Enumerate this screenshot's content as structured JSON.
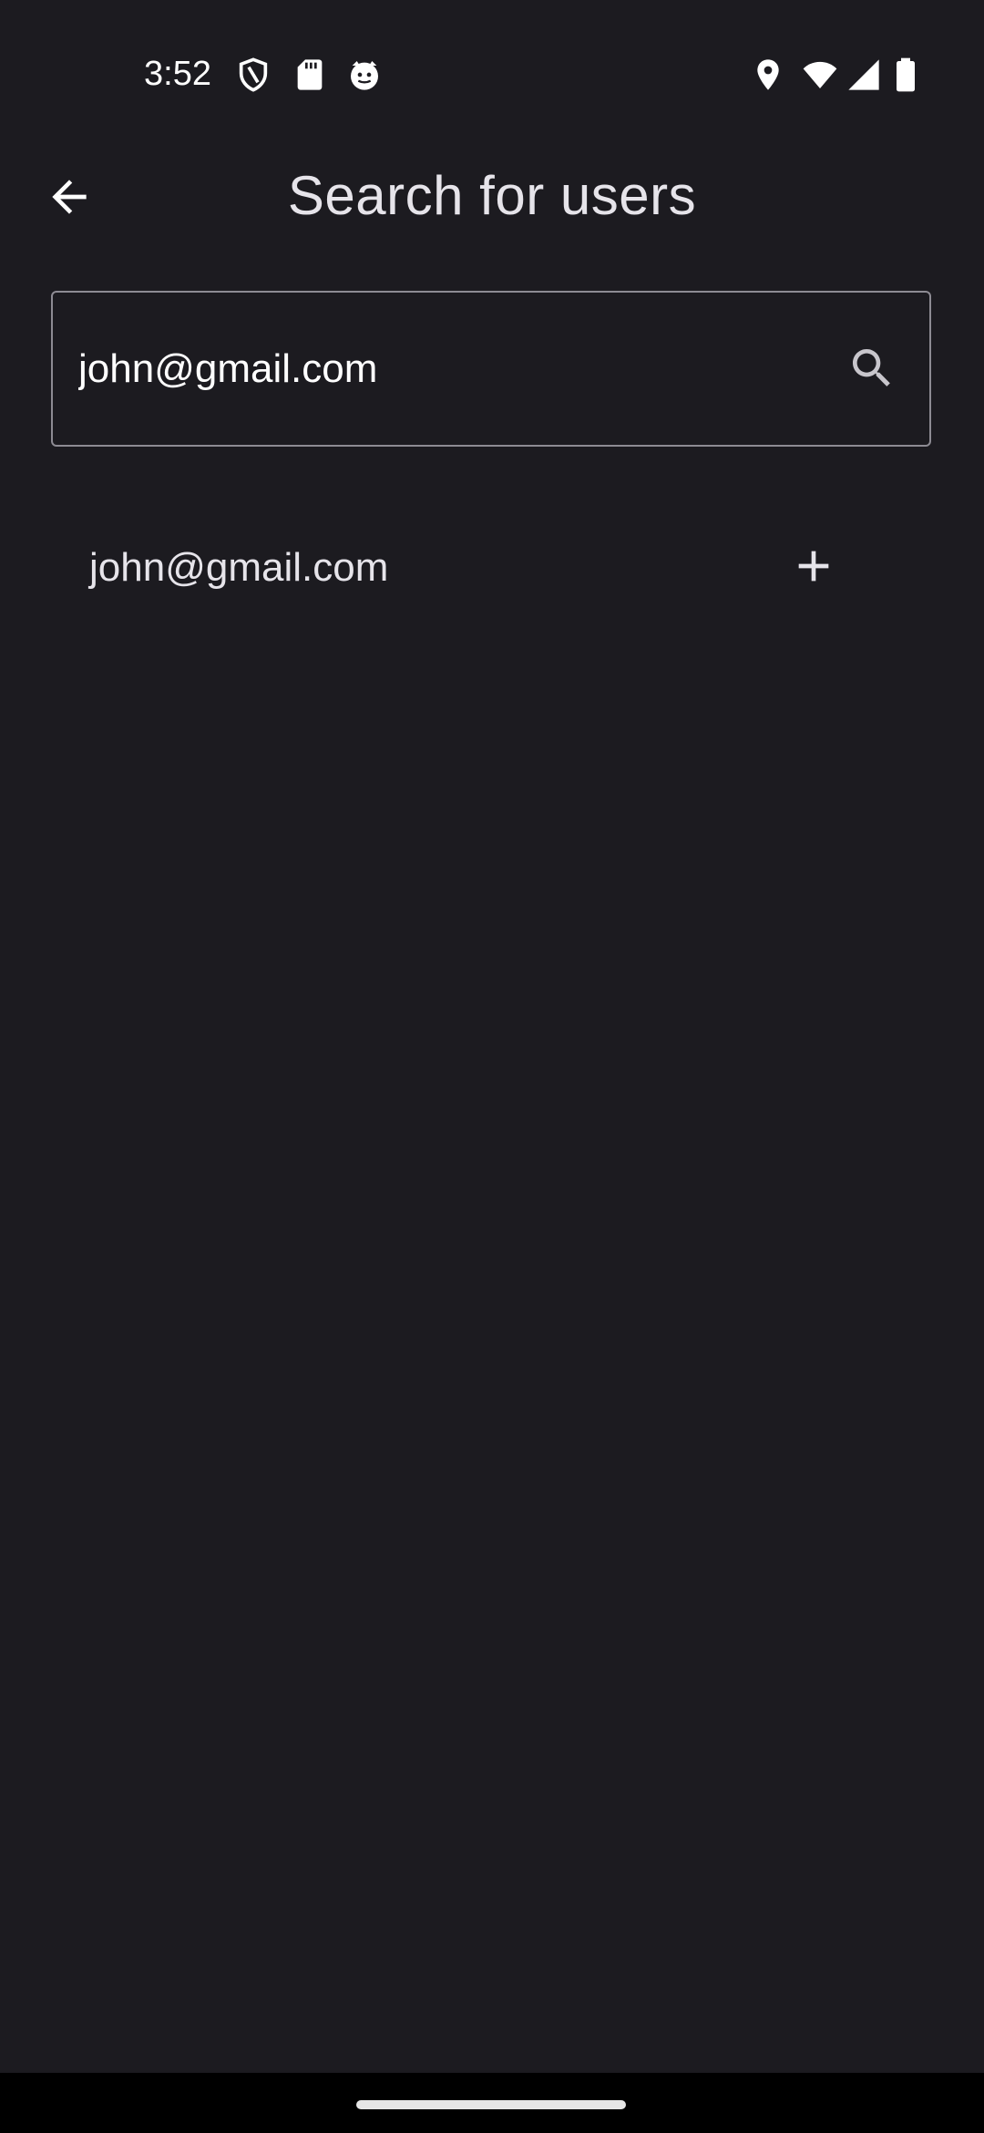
{
  "status_bar": {
    "time": "3:52",
    "left_icons": [
      "shield-icon",
      "sd-card-icon",
      "cat-face-icon"
    ],
    "right_icons": [
      "location-icon",
      "wifi-icon",
      "signal-icon",
      "battery-icon"
    ]
  },
  "app_bar": {
    "title": "Search for users",
    "back_icon": "arrow-back-icon"
  },
  "search": {
    "value": "john@gmail.com",
    "icon": "search-icon"
  },
  "results": [
    {
      "email": "john@gmail.com",
      "action_icon": "add-icon"
    }
  ],
  "colors": {
    "background": "#1c1b20",
    "text": "#e6e4ea",
    "outline": "#8d8b93",
    "nav_bar": "#000000"
  }
}
